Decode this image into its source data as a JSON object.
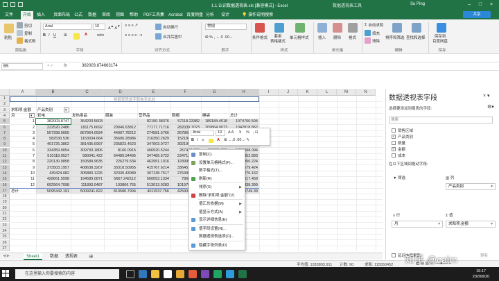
{
  "window": {
    "title": "1.1.认识数据透视表.xls [兼容模式] - Excel",
    "tool_context": "数据透视表工具",
    "user": "Su Ping"
  },
  "ribbon_tabs": [
    "文件",
    "开始",
    "插入",
    "页面布局",
    "公式",
    "数据",
    "审阅",
    "视图",
    "帮助",
    "PDF工具集",
    "Acrobat",
    "百度网盘",
    "分析",
    "设计"
  ],
  "active_tab": "开始",
  "tell_me": "操作说明搜索",
  "share_label": "共享",
  "ribbon": {
    "clipboard": {
      "cut": "剪切",
      "copy": "复制",
      "painter": "格式刷",
      "paste": "粘贴",
      "group": "剪贴板"
    },
    "font": {
      "name": "Arial",
      "size": "10",
      "group": "字体"
    },
    "alignment": {
      "wrap": "自动换行",
      "merge": "合并后居中",
      "group": "对齐方式"
    },
    "number": {
      "format": "常规",
      "group": "数字"
    },
    "styles": {
      "conditional": "条件格式",
      "table": "套用\n表格格式",
      "cell": "单元格样式",
      "group": "样式"
    },
    "cells": {
      "insert": "插入",
      "delete": "删除",
      "format": "格式",
      "group": "单元格"
    },
    "editing": {
      "autosum": "自动求和",
      "fill": "填充",
      "clear": "清除",
      "sort": "排序和筛选",
      "find": "查找和选择",
      "group": "编辑"
    },
    "baidu": {
      "save": "保存到\n百度网盘",
      "group": "保存"
    }
  },
  "formula_bar": {
    "namebox": "B5",
    "fx": "fx",
    "value": "382003.874663174"
  },
  "columns": [
    "A",
    "B",
    "C",
    "D",
    "E",
    "F",
    "G",
    "H",
    "I",
    "J",
    "K",
    "L",
    "M",
    "N"
  ],
  "rows": [
    "1",
    "2",
    "3",
    "4",
    "5",
    "6",
    "7",
    "8",
    "9",
    "10",
    "11",
    "12",
    "13",
    "14",
    "15",
    "16",
    "17",
    "18",
    "19",
    "20",
    "21",
    "22",
    "23",
    "24",
    "25",
    "26",
    "27"
  ],
  "sheet": {
    "drop_hint": "将报表筛选字段拖至此处",
    "sum_label": "求和项:金额",
    "col_field": "产品类别",
    "row_field": "月",
    "headers": [
      "彩电",
      "发热用品",
      "服装",
      "营养品",
      "鞋帽",
      "睡袋",
      "总计"
    ],
    "row_labels": [
      "1",
      "2",
      "3",
      "4",
      "5",
      "6",
      "7",
      "8",
      "9",
      "10",
      "11",
      "12",
      "总计"
    ],
    "data": [
      [
        "382003.8747",
        "364203.5603",
        "",
        "82190.38376",
        "57118.23382",
        "189184.4518",
        "1074700.504"
      ],
      [
        "222520.2486",
        "181175.6692",
        "20040.63812",
        "77177.71716",
        "282039.7023",
        "209864.9073",
        "1042818.862"
      ],
      [
        "507398.0605",
        "867964.0934",
        "44997.78212",
        "274581.5766",
        "267860.3368",
        "",
        "2121082.658"
      ],
      [
        "582530.536",
        "1153034.664",
        "35606.28986",
        "216350.2629",
        "152184.7694",
        "",
        "2156106.124"
      ],
      [
        "401726.3802",
        "381435.6997",
        "235823.4623",
        "347903.0727",
        "392195.9283",
        "",
        "1975028.581"
      ],
      [
        "334359.9054",
        "309793.1806",
        "8160.0915",
        "406920.5244",
        "257433.083",
        "439731.239",
        "1756398.094"
      ],
      [
        "510118.9527",
        "580041.422",
        "64489.94495",
        "347489.6722",
        "234712.9597",
        "",
        "1816452.893"
      ],
      [
        "220130.0858",
        "150589.9635",
        "226279.634",
        "462951.1016",
        "193999.3078",
        "",
        "1253950.224"
      ],
      [
        "373503.1957",
        "408638.3207",
        "33318.50955",
        "415767.6214",
        "336451.7741",
        "",
        "1567679.424"
      ],
      [
        "439424.082",
        "305883.1226",
        "32330.43089",
        "307138.7517",
        "276499.7218",
        "",
        "1361276.162"
      ],
      [
        "428661.5598",
        "194589.0871",
        "5667.242112",
        "560053.1334",
        "786852.41",
        "",
        "2042817.459"
      ],
      [
        "692964.7098",
        "111893.0487",
        "103866.765",
        "513013.9283",
        "1019700.945",
        "",
        "2441438.399"
      ],
      [
        "5095342.191",
        "5009241.822",
        "810580.7904",
        "4011537.756",
        "4259049.172",
        "",
        "20609749.39"
      ]
    ]
  },
  "mini_toolbar": {
    "font": "Arial",
    "size": "10",
    "currency": "¥",
    "percent": "%"
  },
  "context_menu": [
    {
      "label": "复制(C)",
      "icon": "copy-icon",
      "sub": false
    },
    {
      "label": "设置单元格格式(F)...",
      "icon": "format-cells-icon",
      "sub": false
    },
    {
      "label": "数字格式(T)...",
      "icon": "",
      "sub": false
    },
    {
      "label": "刷新(R)",
      "icon": "refresh-icon",
      "sub": false
    },
    {
      "label": "排序(S)",
      "icon": "",
      "sub": true
    },
    {
      "label": "删除\"求和项:金额\"(V)",
      "icon": "delete-icon",
      "sub": false
    },
    {
      "label": "值汇总依据(M)",
      "icon": "",
      "sub": true
    },
    {
      "label": "值显示方式(A)",
      "icon": "",
      "sub": true
    },
    {
      "label": "显示详细信息(E)",
      "icon": "details-icon",
      "sub": false
    },
    {
      "label": "值字段设置(N)...",
      "icon": "field-settings-icon",
      "sub": false
    },
    {
      "label": "数据透视表选项(O)...",
      "icon": "",
      "sub": false
    },
    {
      "label": "隐藏字段列表(D)",
      "icon": "field-list-icon",
      "sub": false
    }
  ],
  "sheet_tabs": [
    "Sheet1",
    "数据",
    "透视表"
  ],
  "active_sheet": "Sheet1",
  "status": {
    "average": "平均值: 1283893.911",
    "count": "计数: 90",
    "sum": "求和: 115550452"
  },
  "pane": {
    "title": "数据透视表字段",
    "subtitle": "选择要添加到报表的字段:",
    "search_placeholder": "搜索",
    "fields": [
      {
        "name": "销售区域",
        "checked": false
      },
      {
        "name": "产品类别",
        "checked": true
      },
      {
        "name": "数量",
        "checked": false
      },
      {
        "name": "金额",
        "checked": true
      },
      {
        "name": "成本",
        "checked": false
      }
    ],
    "drag_hint": "在以下区域间拖动字段:",
    "filters": "筛选",
    "columns": "列",
    "col_item": "产品类别",
    "rows": "行",
    "row_item": "月",
    "values": "值",
    "value_item": "求和项:金额",
    "defer": "延迟布局更新",
    "update": "更新"
  },
  "taskbar": {
    "search": "在这里输入你要搜索的内容",
    "time": "15:17",
    "date": "2020/9/20"
  },
  "watermark": "知乎 @calm"
}
